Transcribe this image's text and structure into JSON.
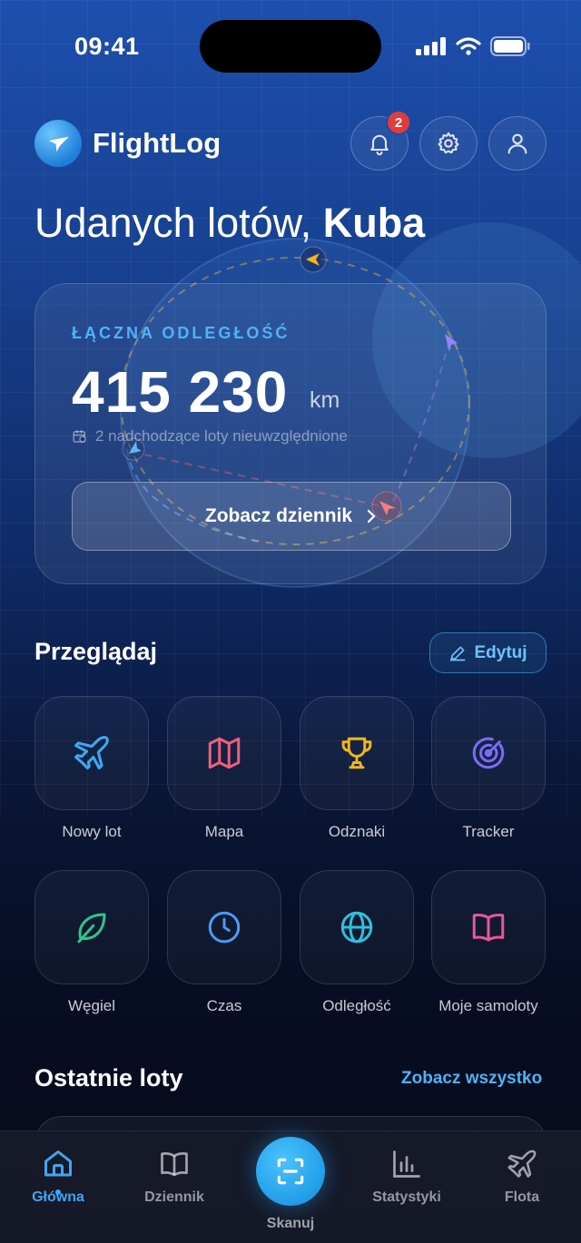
{
  "status_bar": {
    "time": "09:41"
  },
  "header": {
    "app_name": "FlightLog",
    "notification_count": "2"
  },
  "greeting": {
    "prefix": "Udanych lotów,",
    "name": "Kuba"
  },
  "hero": {
    "label": "ŁĄCZNA ODLEGŁOŚĆ",
    "value": "415 230",
    "unit": "km",
    "note": "2 nadchodzące loty nieuwzględnione",
    "button_label": "Zobacz dziennik"
  },
  "browse": {
    "title": "Przeglądaj",
    "edit_label": "Edytuj",
    "tiles": [
      {
        "label": "Nowy lot",
        "icon": "plane-icon",
        "color": "#3fa7f0"
      },
      {
        "label": "Mapa",
        "icon": "map-icon",
        "color": "#f0607a"
      },
      {
        "label": "Odznaki",
        "icon": "trophy-icon",
        "color": "#f2b51c"
      },
      {
        "label": "Tracker",
        "icon": "radar-icon",
        "color": "#7b6cf6"
      },
      {
        "label": "Węgiel",
        "icon": "leaf-icon",
        "color": "#2fc78a"
      },
      {
        "label": "Czas",
        "icon": "clock-icon",
        "color": "#4a9cf5"
      },
      {
        "label": "Odległość",
        "icon": "globe-icon",
        "color": "#2ec1dc"
      },
      {
        "label": "Moje samoloty",
        "icon": "book-icon",
        "color": "#e9579a"
      }
    ]
  },
  "recent": {
    "title": "Ostatnie loty",
    "see_all": "Zobacz wszystko"
  },
  "tab_bar": {
    "tabs": [
      {
        "label": "Główna",
        "icon": "home-icon",
        "active": true
      },
      {
        "label": "Dziennik",
        "icon": "book-open-icon",
        "active": false
      },
      {
        "label": "Skanuj",
        "icon": "scan-icon",
        "active": false
      },
      {
        "label": "Statystyki",
        "icon": "bar-chart-icon",
        "active": false
      },
      {
        "label": "Flota",
        "icon": "plane-icon",
        "active": false
      }
    ]
  },
  "colors": {
    "accent": "#3fa7f0",
    "badge": "#e23b3b"
  }
}
